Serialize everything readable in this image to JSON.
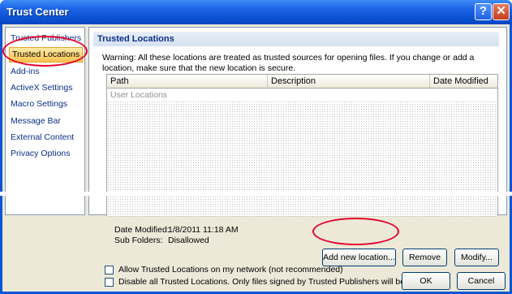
{
  "window": {
    "title": "Trust Center",
    "help_glyph": "?",
    "close_glyph": "✕"
  },
  "sidebar": {
    "items": [
      {
        "label": "Trusted Publishers"
      },
      {
        "label": "Trusted Locations"
      },
      {
        "label": "Add-ins"
      },
      {
        "label": "ActiveX Settings"
      },
      {
        "label": "Macro Settings"
      },
      {
        "label": "Message Bar"
      },
      {
        "label": "External Content"
      },
      {
        "label": "Privacy Options"
      }
    ],
    "selected": "Trusted Locations"
  },
  "main": {
    "section_title": "Trusted Locations",
    "warning": "Warning: All these locations are treated as trusted sources for opening files.  If you change or add a location, make sure that the new location is secure.",
    "table": {
      "columns": [
        "Path",
        "Description",
        "Date Modified"
      ],
      "group_label": "User Locations"
    }
  },
  "details": {
    "date_modified_label": "Date Modified:",
    "date_modified_value": "1/8/2011 11:18 AM",
    "sub_folders_label": "Sub Folders:",
    "sub_folders_value": "Disallowed"
  },
  "buttons": {
    "add": "Add new location...",
    "remove": "Remove",
    "modify": "Modify...",
    "ok": "OK",
    "cancel": "Cancel"
  },
  "checkboxes": {
    "allow_network": {
      "label": "Allow Trusted Locations on my network (not recommended)",
      "checked": false
    },
    "disable_all": {
      "label": "Disable all Trusted Locations. Only files signed by Trusted Publishers will be trusted.",
      "checked": false
    }
  },
  "colors": {
    "annotation": "#e4002b",
    "title_bar": "#0a56d6",
    "selection": "#fbc34f"
  }
}
